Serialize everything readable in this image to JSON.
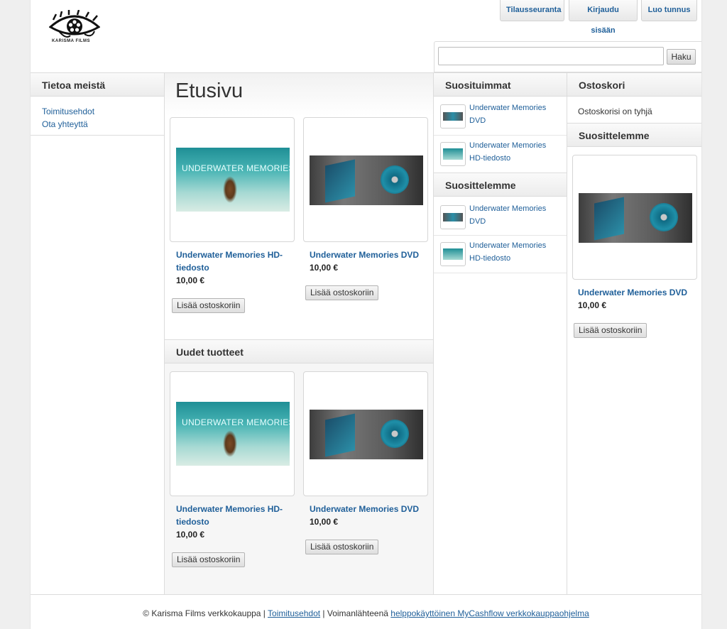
{
  "brand": {
    "logo_text": "KARISMA FILMS"
  },
  "top_nav": [
    "Tilausseuranta",
    "Kirjaudu sisään",
    "Luo tunnus"
  ],
  "search": {
    "button_label": "Haku",
    "value": ""
  },
  "left": {
    "title": "Tietoa meistä",
    "links": [
      "Toimitusehdot",
      "Ota yhteyttä"
    ]
  },
  "main": {
    "page_title": "Etusivu",
    "new_section_title": "Uudet tuotteet",
    "products": [
      {
        "name": "Underwater Memories HD-tiedosto",
        "price": "10,00 €",
        "button": "Lisää ostoskoriin",
        "image": "underwater-memories-cover"
      },
      {
        "name": "Underwater Memories DVD",
        "price": "10,00 €",
        "button": "Lisää ostoskoriin",
        "image": "dvd-case-and-disc"
      }
    ],
    "new_products": [
      {
        "name": "Underwater Memories HD-tiedosto",
        "price": "10,00 €",
        "button": "Lisää ostoskoriin",
        "image": "underwater-memories-cover"
      },
      {
        "name": "Underwater Memories DVD",
        "price": "10,00 €",
        "button": "Lisää ostoskoriin",
        "image": "dvd-case-and-disc"
      }
    ],
    "image_caption": "UNDERWATER MEMORIES"
  },
  "popular": {
    "title": "Suosituimmat",
    "items": [
      {
        "line1": "Underwater Memories",
        "line2": "DVD"
      },
      {
        "line1": "Underwater Memories",
        "line2": "HD-tiedosto"
      }
    ]
  },
  "recommend": {
    "title": "Suosittelemme",
    "items": [
      {
        "line1": "Underwater Memories",
        "line2": "DVD"
      },
      {
        "line1": "Underwater Memories",
        "line2": "HD-tiedosto"
      }
    ]
  },
  "cart": {
    "title": "Ostoskori",
    "empty_text": "Ostoskorisi on tyhjä",
    "recommend_title": "Suosittelemme",
    "product": {
      "name": "Underwater Memories DVD",
      "price": "10,00 €",
      "button": "Lisää ostoskoriin"
    }
  },
  "footer": {
    "copyright": "© Karisma Films verkkokauppa | ",
    "terms_link": "Toimitusehdot",
    "powered": " | Voimanlähteenä ",
    "powered_link": "helppokäyttöinen MyCashflow verkkokauppaohjelma"
  }
}
